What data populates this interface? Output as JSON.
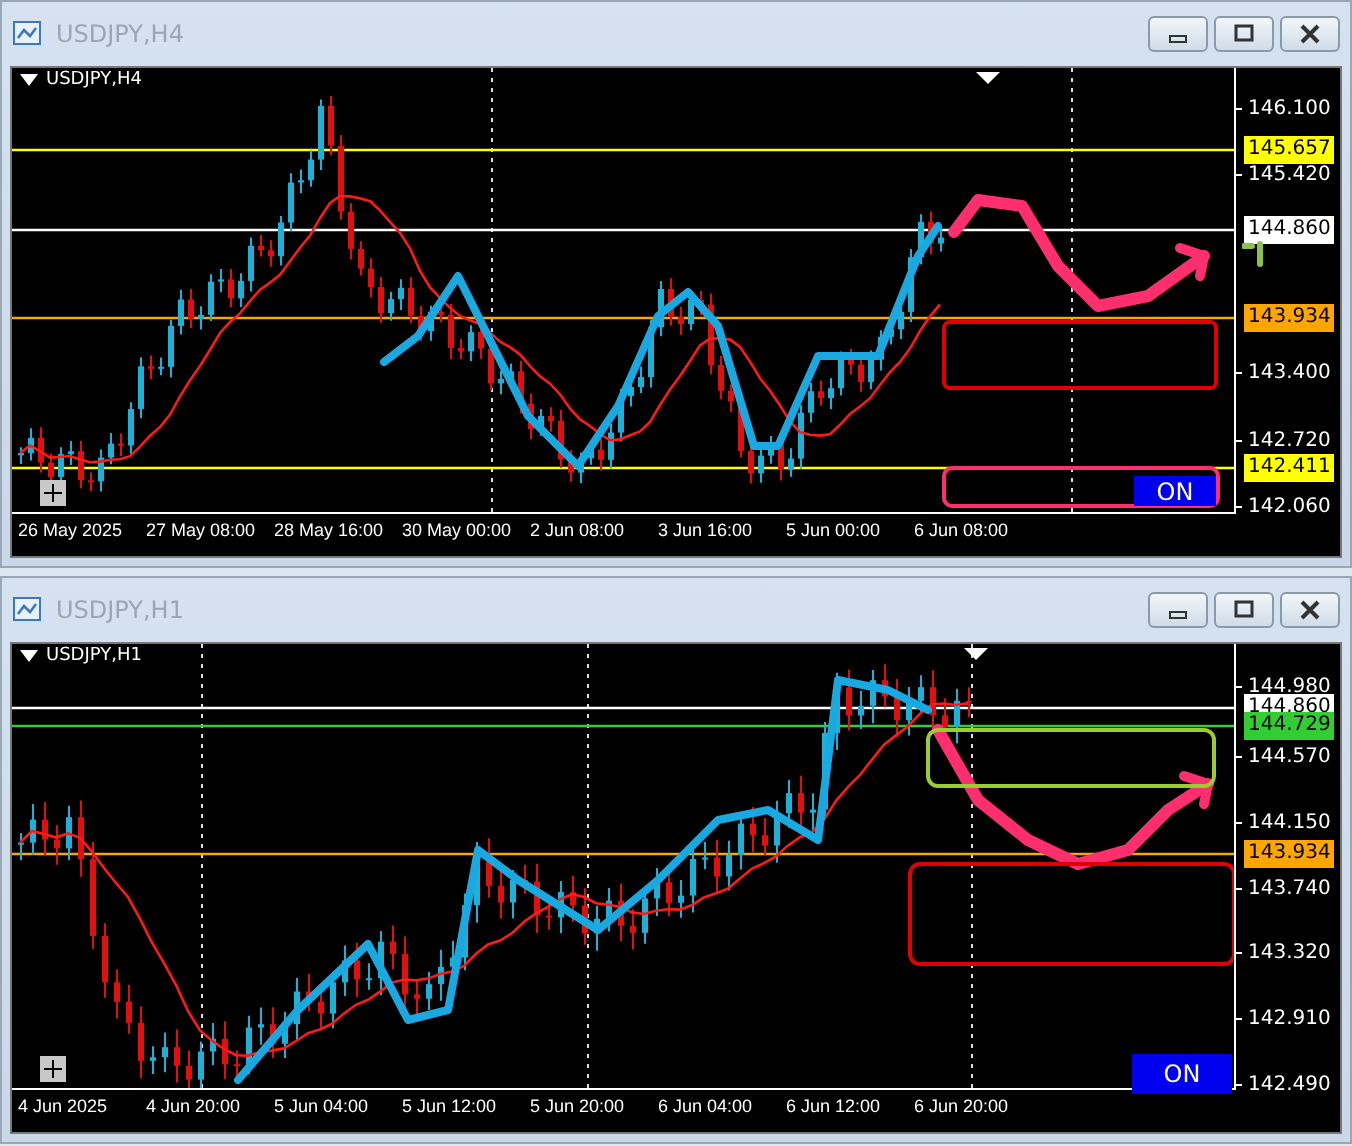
{
  "windows": [
    {
      "title": "USDJPY,H4",
      "chart_label": "USDJPY,H4",
      "price_ticks": [
        "146.100",
        "145.420",
        "143.400",
        "142.720",
        "142.060"
      ],
      "levels": [
        {
          "price": "145.657",
          "color": "#ffff00"
        },
        {
          "price": "144.860",
          "color": "#ffffff"
        },
        {
          "price": "143.934",
          "color": "#ffa500"
        },
        {
          "price": "142.411",
          "color": "#ffff00"
        }
      ],
      "time_labels": [
        "26 May 2025",
        "27 May 08:00",
        "28 May 16:00",
        "30 May 00:00",
        "2 Jun 08:00",
        "3 Jun 16:00",
        "5 Jun 00:00",
        "6 Jun 08:00"
      ],
      "on_button": "ON"
    },
    {
      "title": "USDJPY,H1",
      "chart_label": "USDJPY,H1",
      "price_ticks": [
        "144.980",
        "144.570",
        "144.150",
        "143.740",
        "143.320",
        "142.910",
        "142.490"
      ],
      "levels": [
        {
          "price": "144.860",
          "color": "#ffffff"
        },
        {
          "price": "144.729",
          "color": "#32cd32"
        },
        {
          "price": "143.934",
          "color": "#ffa500"
        }
      ],
      "time_labels": [
        "4 Jun 2025",
        "4 Jun 20:00",
        "5 Jun 04:00",
        "5 Jun 12:00",
        "5 Jun 20:00",
        "6 Jun 04:00",
        "6 Jun 12:00",
        "6 Jun 20:00"
      ],
      "on_button": "ON"
    }
  ]
}
